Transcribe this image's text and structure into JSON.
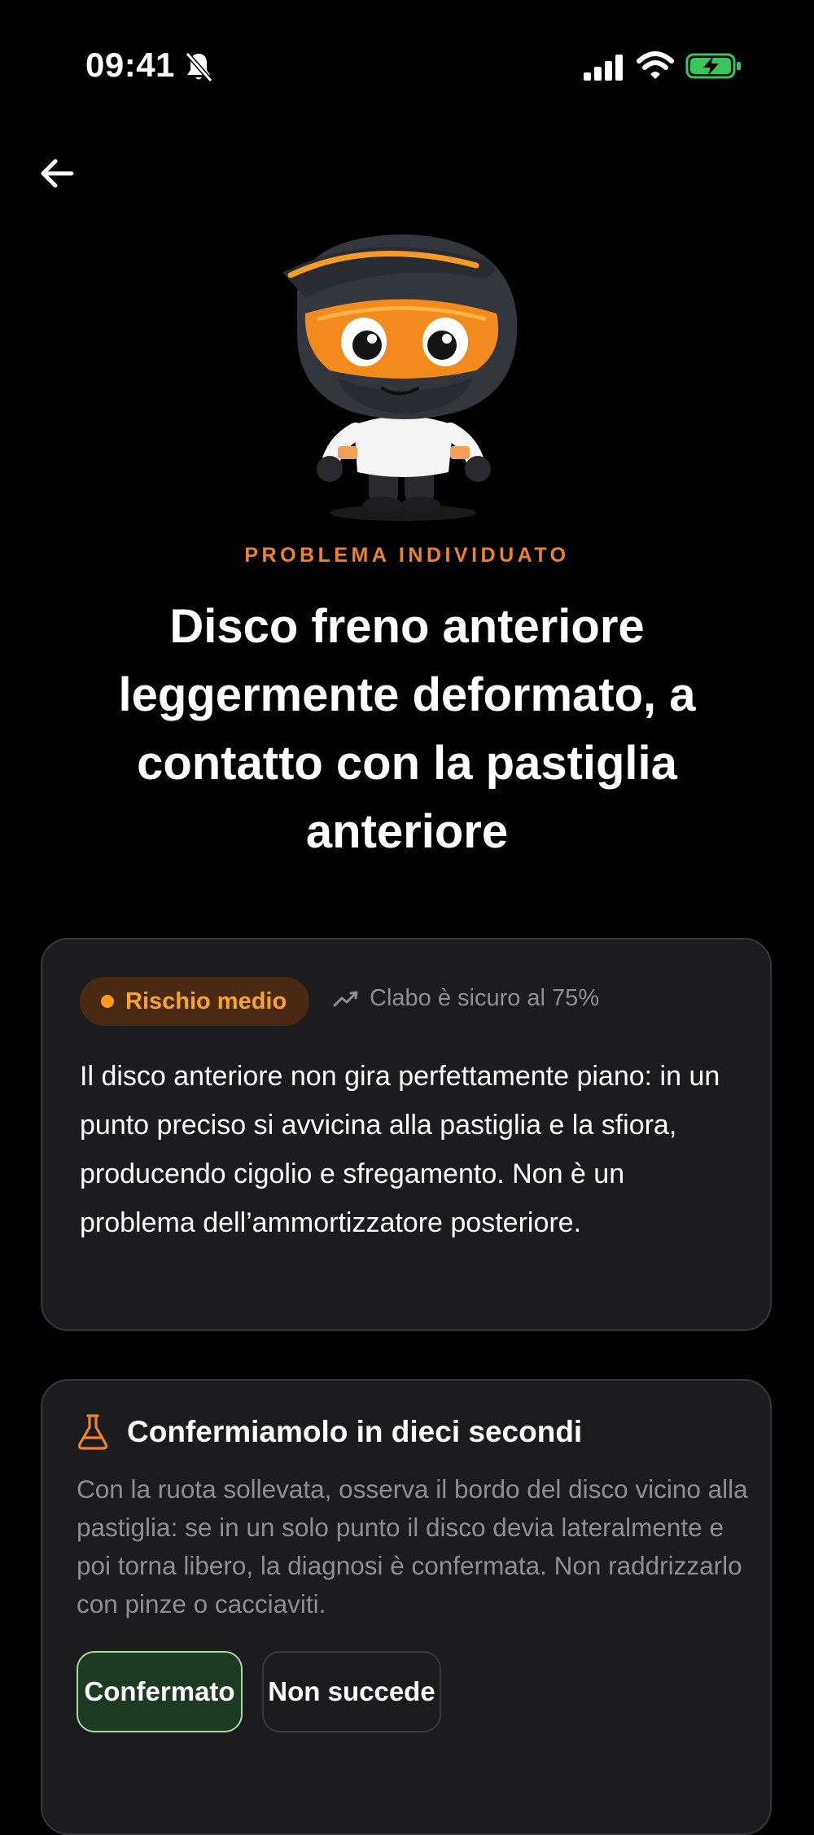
{
  "status_bar": {
    "time": "09:41",
    "battery_color": "#34c759"
  },
  "nav": {
    "back_icon": "arrow-left-icon"
  },
  "hero": {
    "mascot": "helmet-rider-mascot",
    "eyebrow": "PROBLEMA INDIVIDUATO",
    "eyebrow_color": "#f0822a",
    "title": "Disco freno anteriore leggermente deformato, a contatto con la pastiglia anteriore"
  },
  "diagnosis_card": {
    "risk_label": "Rischio medio",
    "risk_color": "#f7a52a",
    "confidence_text": "Clabo è sicuro al 75%",
    "confidence_icon": "trend-icon",
    "description": "Il disco anteriore non gira perfettamente piano: in un punto preciso si avvicina alla pastiglia e la sfiora, producendo cigolio e sfregamento. Non è un problema dell’ammortizzatore posteriore."
  },
  "confirm_card": {
    "icon": "flask-icon",
    "title": "Confermiamolo in dieci secondi",
    "description": "Con la ruota sollevata, osserva il bordo del disco vicino alla pastiglia: se in un solo punto il disco devia lateralmente e poi torna libero, la diagnosi è confermata. Non raddrizzarlo con pinze o cacciaviti.",
    "confirm_button": "Confermato",
    "not_happening_button": "Non succede"
  }
}
